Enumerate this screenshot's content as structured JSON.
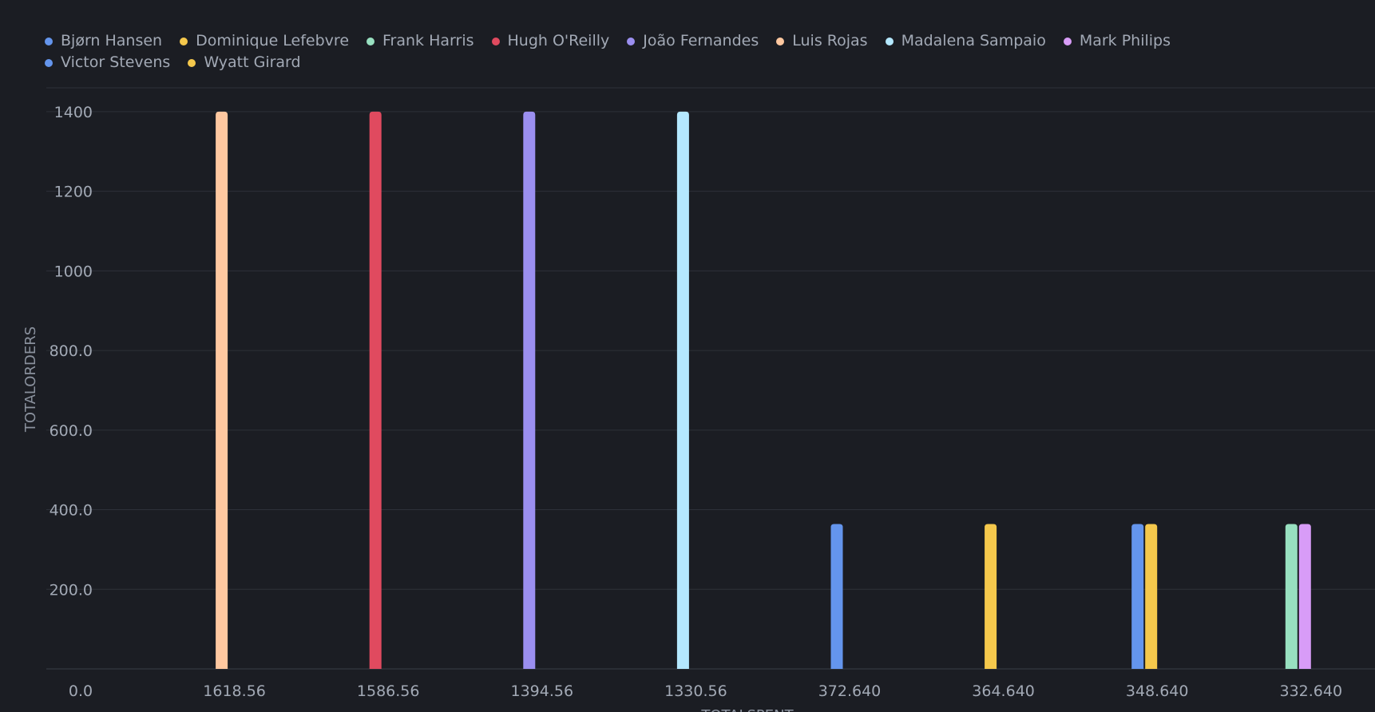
{
  "legend": [
    {
      "name": "Bjørn Hansen",
      "color": "#6495ed"
    },
    {
      "name": "Dominique Lefebvre",
      "color": "#f5c84c"
    },
    {
      "name": "Frank Harris",
      "color": "#98e0c0"
    },
    {
      "name": "Hugh O'Reilly",
      "color": "#e04a5f"
    },
    {
      "name": "João Fernandes",
      "color": "#9b8ff0"
    },
    {
      "name": "Luis Rojas",
      "color": "#ffc8a0"
    },
    {
      "name": "Madalena Sampaio",
      "color": "#b4e8ff"
    },
    {
      "name": "Mark Philips",
      "color": "#d89cf7"
    },
    {
      "name": "Victor Stevens",
      "color": "#6495ed"
    },
    {
      "name": "Wyatt Girard",
      "color": "#f5c84c"
    }
  ],
  "chart_data": {
    "type": "bar",
    "xlabel": "TOTALSPENT",
    "ylabel": "TOTALORDERS",
    "x_tick_labels": [
      "0.0",
      "1618.56",
      "1586.56",
      "1394.56",
      "1330.56",
      "372.640",
      "364.640",
      "348.640",
      "332.640"
    ],
    "y_tick_labels": [
      "200.0",
      "400.0",
      "600.0",
      "800.0",
      "1000",
      "1200",
      "1400"
    ],
    "y_ticks": [
      200,
      400,
      600,
      800,
      1000,
      1200,
      1400
    ],
    "ylim": [
      0,
      1460
    ],
    "grid": true,
    "legend_position": "top",
    "series": [
      {
        "name": "Luis Rojas",
        "color": "#ffc8a0",
        "points": [
          {
            "x": "1618.56",
            "y": 1400
          }
        ]
      },
      {
        "name": "Hugh O'Reilly",
        "color": "#e04a5f",
        "points": [
          {
            "x": "1586.56",
            "y": 1400
          }
        ]
      },
      {
        "name": "João Fernandes",
        "color": "#9b8ff0",
        "points": [
          {
            "x": "1394.56",
            "y": 1400
          }
        ]
      },
      {
        "name": "Madalena Sampaio",
        "color": "#b4e8ff",
        "points": [
          {
            "x": "1330.56",
            "y": 1400
          }
        ]
      },
      {
        "name": "Bjørn Hansen",
        "color": "#6495ed",
        "points": [
          {
            "x": "372.640",
            "y": 364
          }
        ]
      },
      {
        "name": "Dominique Lefebvre",
        "color": "#f5c84c",
        "points": [
          {
            "x": "364.640",
            "y": 364
          }
        ]
      },
      {
        "name": "Victor Stevens",
        "color": "#6495ed",
        "points": [
          {
            "x": "348.640",
            "y": 364
          }
        ]
      },
      {
        "name": "Wyatt Girard",
        "color": "#f5c84c",
        "points": [
          {
            "x": "348.640",
            "y": 364
          }
        ]
      },
      {
        "name": "Frank Harris",
        "color": "#98e0c0",
        "points": [
          {
            "x": "332.640",
            "y": 364
          }
        ]
      },
      {
        "name": "Mark Philips",
        "color": "#d89cf7",
        "points": [
          {
            "x": "332.640",
            "y": 364
          }
        ]
      }
    ]
  }
}
